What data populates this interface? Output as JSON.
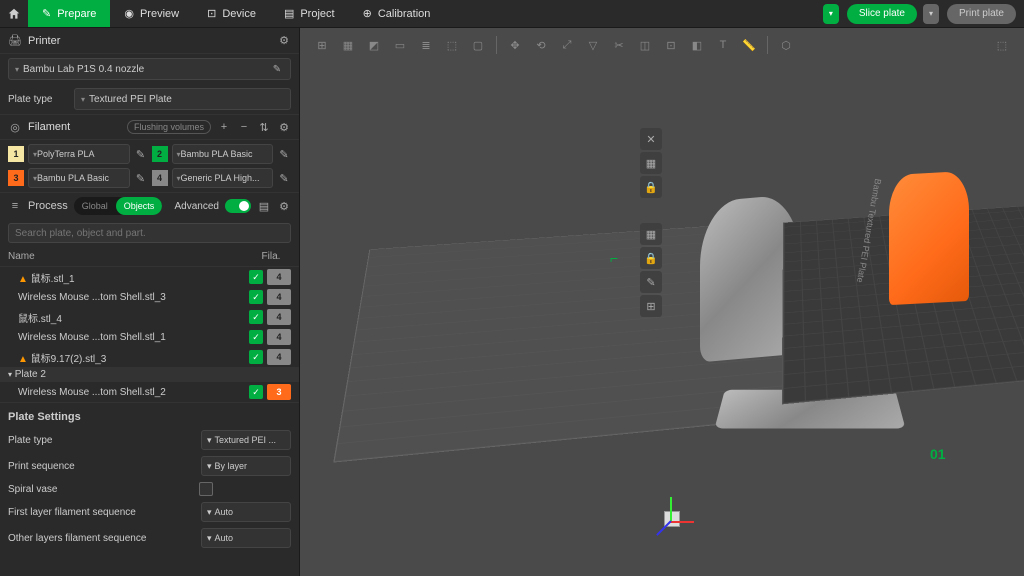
{
  "topbar": {
    "tabs": [
      {
        "label": "Prepare",
        "active": true
      },
      {
        "label": "Preview",
        "active": false
      },
      {
        "label": "Device",
        "active": false
      },
      {
        "label": "Project",
        "active": false
      },
      {
        "label": "Calibration",
        "active": false
      }
    ],
    "slice_label": "Slice plate",
    "print_label": "Print plate"
  },
  "printer": {
    "section_title": "Printer",
    "device": "Bambu Lab P1S 0.4 nozzle",
    "plate_type_label": "Plate type",
    "plate_type_value": "Textured PEI Plate"
  },
  "filament": {
    "section_title": "Filament",
    "flushing_label": "Flushing volumes",
    "items": [
      {
        "num": "1",
        "color": "#f5e6a3",
        "name": "PolyTerra PLA"
      },
      {
        "num": "2",
        "color": "#00ae42",
        "name": "Bambu PLA Basic"
      },
      {
        "num": "3",
        "color": "#ff6b1a",
        "name": "Bambu PLA Basic"
      },
      {
        "num": "4",
        "color": "#888888",
        "name": "Generic PLA High..."
      }
    ]
  },
  "process": {
    "section_title": "Process",
    "seg_global": "Global",
    "seg_objects": "Objects",
    "advanced_label": "Advanced",
    "search_placeholder": "Search plate, object and part.",
    "col_name": "Name",
    "col_fila": "Fila."
  },
  "objects": [
    {
      "name": "鼠标.stl_1",
      "fila": "4",
      "fila_class": "badge-grey",
      "warn": true,
      "check": true
    },
    {
      "name": "Wireless Mouse ...tom Shell.stl_3",
      "fila": "4",
      "fila_class": "badge-grey",
      "warn": false,
      "check": true
    },
    {
      "name": "鼠标.stl_4",
      "fila": "4",
      "fila_class": "badge-grey",
      "warn": false,
      "check": true
    },
    {
      "name": "Wireless Mouse ...tom Shell.stl_1",
      "fila": "4",
      "fila_class": "badge-grey",
      "warn": false,
      "check": true
    },
    {
      "name": "鼠标9.17(2).stl_3",
      "fila": "4",
      "fila_class": "badge-grey",
      "warn": true,
      "check": true
    }
  ],
  "plate2": {
    "group_name": "Plate 2",
    "items": [
      {
        "name": "Wireless Mouse ...tom Shell.stl_2",
        "fila": "3",
        "fila_class": "badge-orange",
        "check": true
      }
    ]
  },
  "plate_settings": {
    "title": "Plate Settings",
    "rows": {
      "plate_type": {
        "label": "Plate type",
        "value": "Textured PEI ..."
      },
      "print_seq": {
        "label": "Print sequence",
        "value": "By layer"
      },
      "spiral": {
        "label": "Spiral vase"
      },
      "first_layer": {
        "label": "First layer filament sequence",
        "value": "Auto"
      },
      "other_layers": {
        "label": "Other layers filament sequence",
        "value": "Auto"
      }
    }
  },
  "viewport": {
    "plate1_label": "01",
    "plate2_surface": "Bambu Textured PEI Plate"
  }
}
